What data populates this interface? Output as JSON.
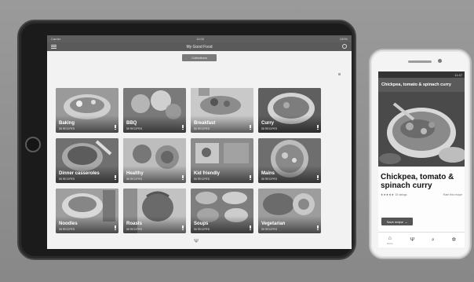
{
  "tablet": {
    "status_left": "Carrier",
    "status_time": "12:00",
    "status_right": "100%",
    "app_title": "My Good Food",
    "tabs": [
      {
        "label": "",
        "active": false
      },
      {
        "label": "Collections",
        "active": true
      },
      {
        "label": "",
        "active": false
      }
    ],
    "list_caption": "",
    "view_label": "",
    "categories": [
      {
        "name": "Baking",
        "count": "55 RECIPES",
        "icon": "cake-photo"
      },
      {
        "name": "BBQ",
        "count": "55 RECIPES",
        "icon": "bbq-photo"
      },
      {
        "name": "Breakfast",
        "count": "55 RECIPES",
        "icon": "breakfast-photo"
      },
      {
        "name": "Curry",
        "count": "55 RECIPES",
        "icon": "curry-photo"
      },
      {
        "name": "Dinner casseroles",
        "count": "55 RECIPES",
        "icon": "casserole-photo"
      },
      {
        "name": "Healthy",
        "count": "55 RECIPES",
        "icon": "healthy-photo"
      },
      {
        "name": "Kid friendly",
        "count": "55 RECIPES",
        "icon": "kid-photo"
      },
      {
        "name": "Mains",
        "count": "55 RECIPES",
        "icon": "mains-photo"
      },
      {
        "name": "Noodles",
        "count": "55 RECIPES",
        "icon": "noodles-photo"
      },
      {
        "name": "Roasts",
        "count": "55 RECIPES",
        "icon": "roast-photo"
      },
      {
        "name": "Soups",
        "count": "55 RECIPES",
        "icon": "soups-photo"
      },
      {
        "name": "Vegetarian",
        "count": "55 RECIPES",
        "icon": "vegetarian-photo"
      }
    ],
    "bottom_icon": "fork-knife-icon"
  },
  "phone": {
    "status_time": "11:47",
    "title": "Chickpea, tomato & spinach curry",
    "heading": "Chickpea, tomato & spinach curry",
    "rating_stars": "★★★★★",
    "ratings_count": "15 ratings",
    "rate_label": "Rate this recipe",
    "save_label": "Save recipe",
    "nav": [
      {
        "label": "Home",
        "icon": "home-icon",
        "glyph": "⌂"
      },
      {
        "label": "",
        "icon": "fork-knife-icon",
        "glyph": "Ψ"
      },
      {
        "label": "",
        "icon": "search-icon",
        "glyph": "⌕"
      },
      {
        "label": "",
        "icon": "gear-icon",
        "glyph": "✲"
      }
    ]
  },
  "colors": {
    "background": "#8f8f8f",
    "app_bar": "#5a5a5a",
    "tablet_frame": "#1b1b1b",
    "phone_frame": "#f4f4f4"
  }
}
